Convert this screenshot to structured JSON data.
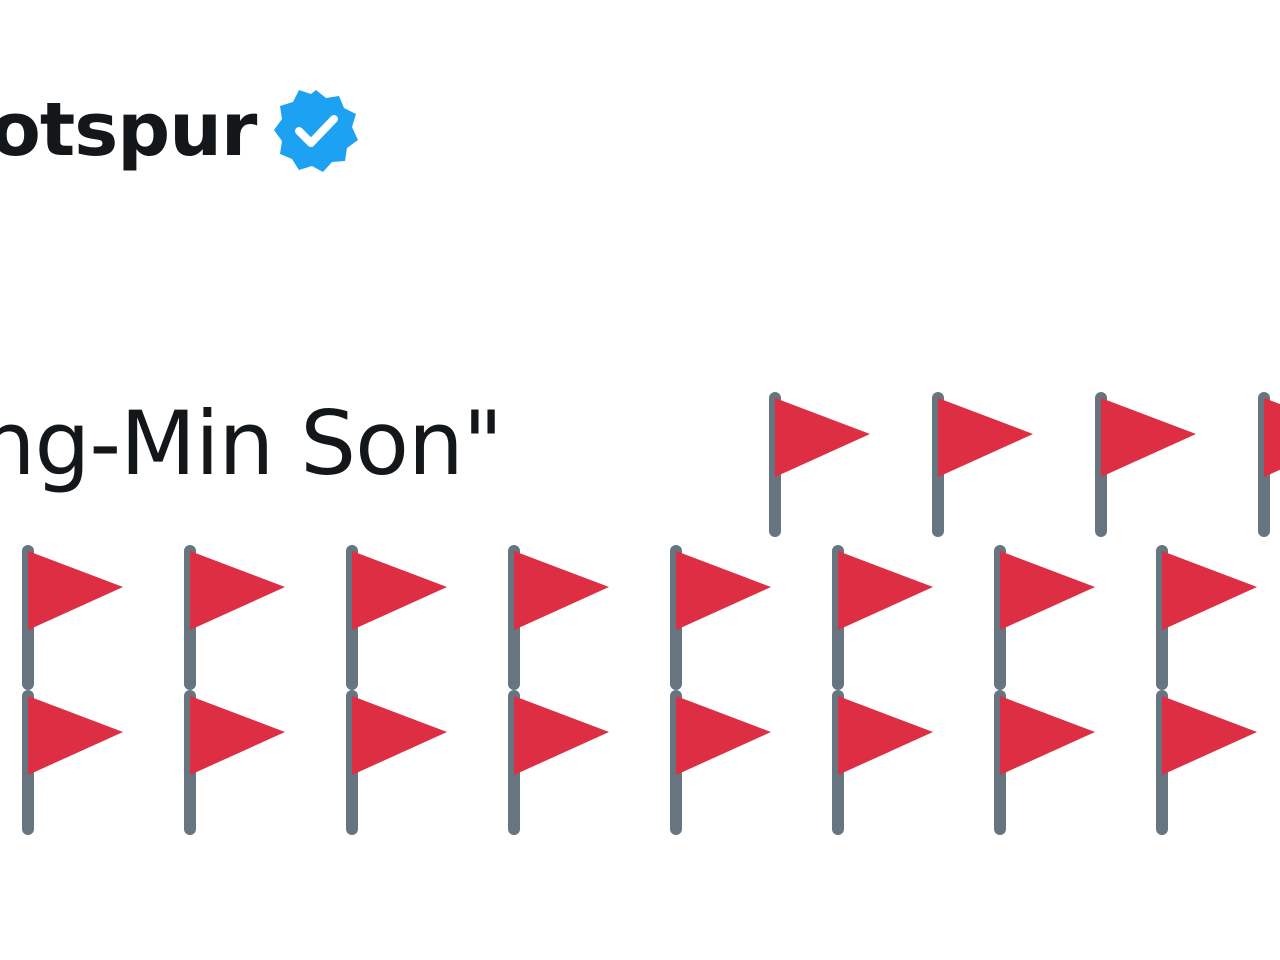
{
  "tweet": {
    "display_name": "otspur",
    "verified_badge": "verified-badge-icon",
    "text": "ung-Min Son\"",
    "flag_emoji": "red-triangular-flag-icon",
    "flag_count_row1": 4,
    "flag_count_row2": 8,
    "flag_count_row3": 8
  },
  "colors": {
    "flag_red": "#dd2e44",
    "flag_pole": "#66757f",
    "verified_blue": "#1da1f2",
    "text": "#14171a"
  }
}
